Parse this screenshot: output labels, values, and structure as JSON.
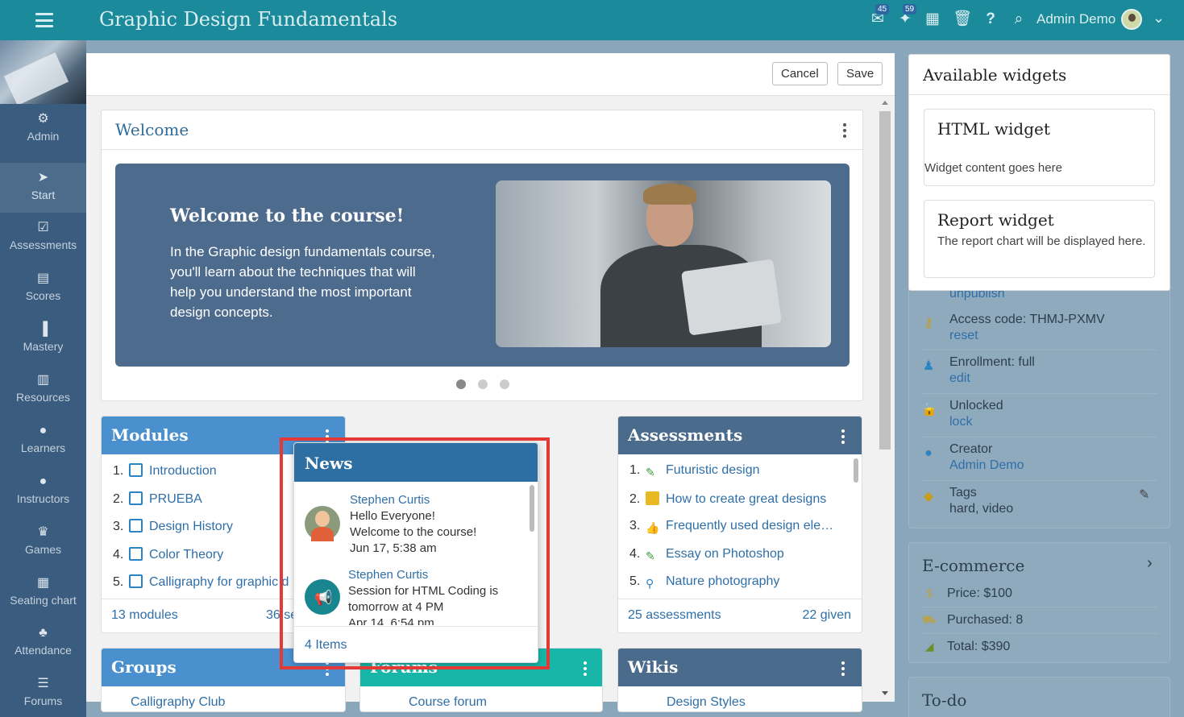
{
  "topbar": {
    "title": "Graphic Design Fundamentals",
    "user": "Admin Demo",
    "mail_badge": "45",
    "notif_badge": "59"
  },
  "sidebar": {
    "items": [
      {
        "label": "Admin",
        "icon": "gear-icon"
      },
      {
        "label": "Start",
        "icon": "navigation-icon"
      },
      {
        "label": "Assessments",
        "icon": "checkbox-icon"
      },
      {
        "label": "Scores",
        "icon": "gradebook-icon"
      },
      {
        "label": "Mastery",
        "icon": "bar-chart-icon"
      },
      {
        "label": "Resources",
        "icon": "books-icon"
      },
      {
        "label": "Learners",
        "icon": "user-icon"
      },
      {
        "label": "Instructors",
        "icon": "instructor-icon"
      },
      {
        "label": "Games",
        "icon": "trophy-icon"
      },
      {
        "label": "Seating chart",
        "icon": "seating-icon"
      },
      {
        "label": "Attendance",
        "icon": "attendance-icon"
      },
      {
        "label": "Forums",
        "icon": "forums-icon"
      }
    ]
  },
  "editor": {
    "cancel": "Cancel",
    "save": "Save"
  },
  "welcome": {
    "title": "Welcome",
    "heading": "Welcome to the course!",
    "text": "In the Graphic design fundamentals course, you'll learn about the techniques that will help you understand the most important design concepts."
  },
  "modules": {
    "title": "Modules",
    "items": [
      {
        "n": "1.",
        "label": "Introduction"
      },
      {
        "n": "2.",
        "label": "PRUEBA"
      },
      {
        "n": "3.",
        "label": "Design History"
      },
      {
        "n": "4.",
        "label": "Color Theory"
      },
      {
        "n": "5.",
        "label": "Calligraphy for graphic d"
      }
    ],
    "footer_left": "13 modules",
    "footer_right": "36 se"
  },
  "news": {
    "title": "News",
    "items": [
      {
        "author": "Stephen Curtis",
        "line1": "Hello Everyone!",
        "line2": "Welcome to the course!",
        "date": "Jun 17, 5:38 am"
      },
      {
        "author": "Stephen Curtis",
        "line1": "Session for HTML Coding is",
        "line2": "tomorrow at 4 PM",
        "date": "Apr 14, 6:54 pm"
      }
    ],
    "footer": "4 Items"
  },
  "assessments": {
    "title": "Assessments",
    "items": [
      {
        "n": "1.",
        "label": "Futuristic design"
      },
      {
        "n": "2.",
        "label": "How to create great designs"
      },
      {
        "n": "3.",
        "label": "Frequently used design ele…"
      },
      {
        "n": "4.",
        "label": "Essay on Photoshop"
      },
      {
        "n": "5.",
        "label": "Nature photography"
      }
    ],
    "footer_left": "25 assessments",
    "footer_right": "22 given"
  },
  "groups": {
    "title": "Groups",
    "item": "Calligraphy Club"
  },
  "forums": {
    "title": "Forums",
    "item": "Course forum"
  },
  "wikis": {
    "title": "Wikis",
    "item": "Design Styles"
  },
  "available": {
    "title": "Available widgets",
    "html_title": "HTML widget",
    "html_desc": "Widget content goes here",
    "report_title": "Report widget",
    "report_desc": "The report chart will be displayed here."
  },
  "info": {
    "unpublish": "unpublish",
    "access": "Access code: THMJ-PXMV",
    "access_link": "reset",
    "enrollment": "Enrollment: full",
    "enrollment_link": "edit",
    "unlocked": "Unlocked",
    "unlocked_link": "lock",
    "creator": "Creator",
    "creator_link": "Admin Demo",
    "tags": "Tags",
    "tags_value": "hard, video"
  },
  "ecommerce": {
    "title": "E-commerce",
    "price": "Price: $100",
    "purchased": "Purchased: 8",
    "total": "Total: $390"
  },
  "todo": {
    "title": "To-do"
  },
  "colors": {
    "topbar": "#1b8a9a",
    "sidebar": "#3a5c7e",
    "modules": "#4a90cf",
    "news": "#2e6fa3",
    "assessments": "#4a6b8c",
    "forums": "#18b6a8",
    "highlight": "#e53935"
  }
}
